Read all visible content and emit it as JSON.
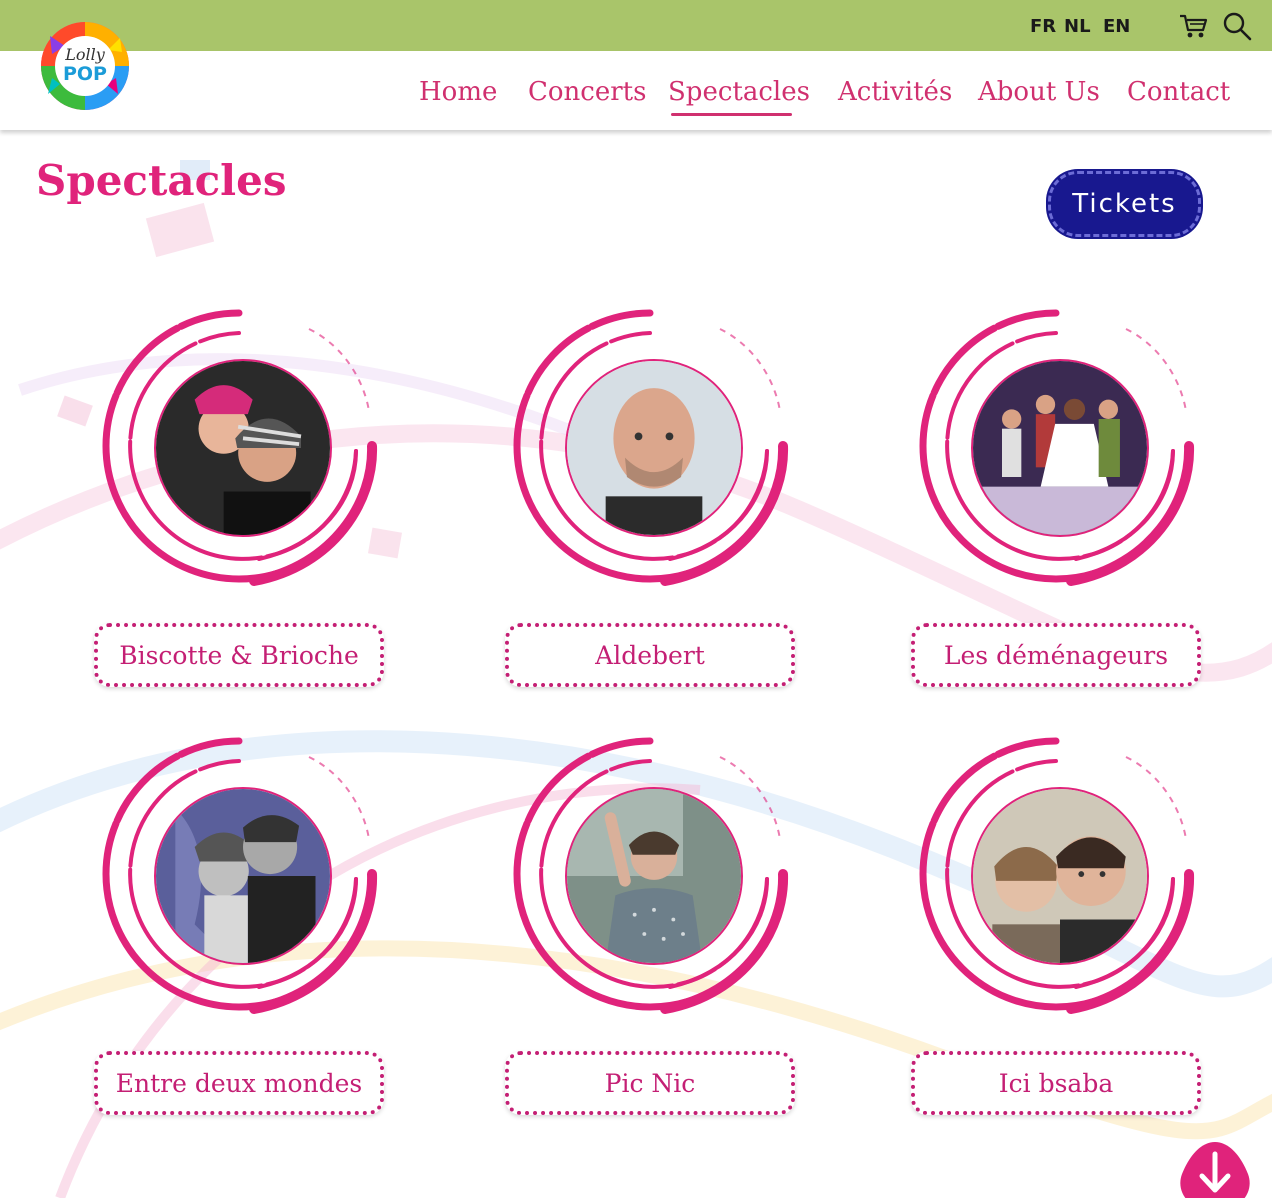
{
  "topbar": {
    "languages": [
      "FR",
      "NL",
      "EN"
    ],
    "cart_icon": "cart-icon",
    "search_icon": "search-icon"
  },
  "logo": {
    "line1": "Lolly",
    "line2": "POP"
  },
  "nav": {
    "items": [
      "Home",
      "Concerts",
      "Spectacles",
      "Activités",
      "About Us",
      "Contact"
    ],
    "active": "Spectacles"
  },
  "page": {
    "title": "Spectacles",
    "tickets_label": "Tickets"
  },
  "shows": [
    {
      "name": "Biscotte & Brioche"
    },
    {
      "name": "Aldebert"
    },
    {
      "name": "Les déménageurs"
    },
    {
      "name": "Entre deux mondes"
    },
    {
      "name": "Pic Nic"
    },
    {
      "name": "Ici bsaba"
    }
  ],
  "colors": {
    "topbar": "#a9c56a",
    "accent_pink": "#e0237b",
    "nav_text": "#d0306f",
    "tickets_bg": "#18188f"
  },
  "scroll_icon": "arrow-down-icon"
}
